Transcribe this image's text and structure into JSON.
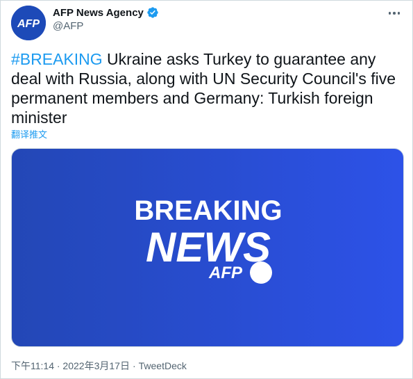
{
  "account": {
    "avatar_text": "AFP",
    "display_name": "AFP News Agency",
    "handle": "@AFP"
  },
  "tweet": {
    "hashtag": "#BREAKING",
    "body": " Ukraine asks Turkey to guarantee any deal with Russia, along with UN Security Council's five permanent members and Germany: Turkish foreign minister",
    "translate_label": "翻译推文"
  },
  "media": {
    "line1": "BREAKING",
    "line2": "NEWS",
    "brand": "AFP"
  },
  "footer": {
    "timestamp": "下午11:14 · 2022年3月17日",
    "separator": "·",
    "source": "TweetDeck"
  },
  "colors": {
    "link": "#1d9bf0",
    "verified": "#1d9bf0",
    "avatar_bg": "#1d4ab8",
    "media_left": "#2347b6",
    "media_right": "#2d52e8"
  },
  "icons": {
    "verified": "verified-badge-icon",
    "more": "more-options-icon"
  }
}
